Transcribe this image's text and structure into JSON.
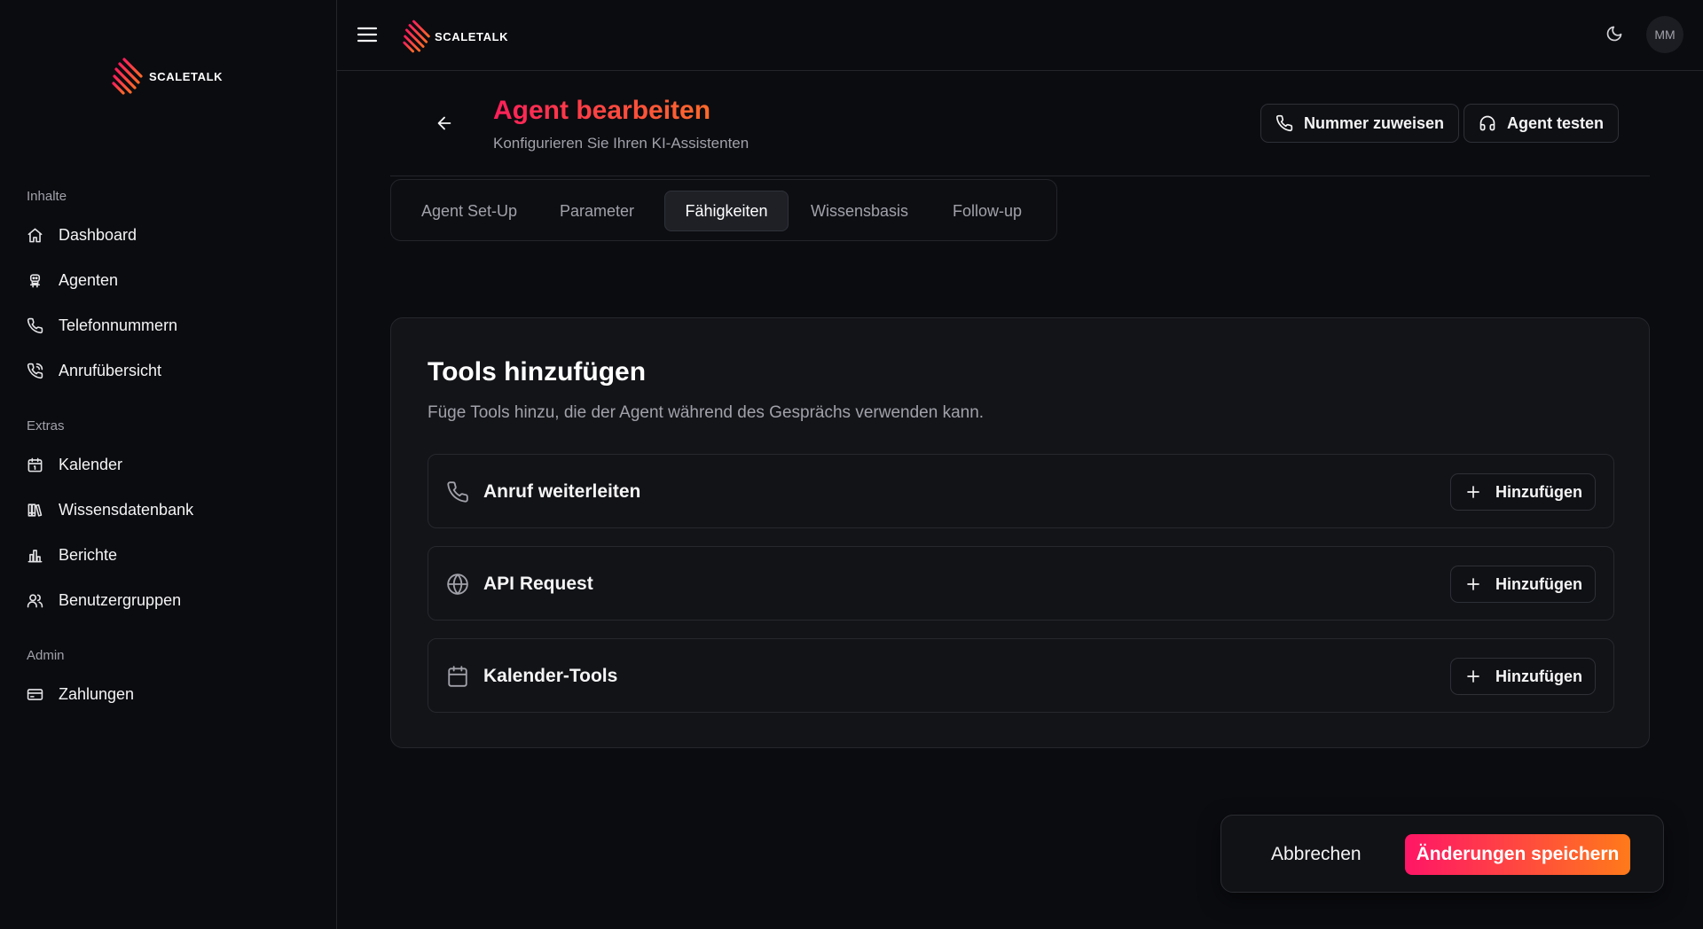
{
  "brand": {
    "name": "SCALETALK"
  },
  "sidebar": {
    "sections": [
      {
        "label": "Inhalte",
        "items": [
          {
            "label": "Dashboard",
            "icon": "home-icon"
          },
          {
            "label": "Agenten",
            "icon": "robot-icon"
          },
          {
            "label": "Telefonnummern",
            "icon": "phone-icon"
          },
          {
            "label": "Anrufübersicht",
            "icon": "phone-call-icon"
          }
        ]
      },
      {
        "label": "Extras",
        "items": [
          {
            "label": "Kalender",
            "icon": "calendar-icon"
          },
          {
            "label": "Wissensdatenbank",
            "icon": "library-icon"
          },
          {
            "label": "Berichte",
            "icon": "bar-chart-icon"
          },
          {
            "label": "Benutzergruppen",
            "icon": "users-icon"
          }
        ]
      },
      {
        "label": "Admin",
        "items": [
          {
            "label": "Zahlungen",
            "icon": "credit-card-icon"
          }
        ]
      }
    ]
  },
  "topbar": {
    "avatar_initials": "MM"
  },
  "header": {
    "title": "Agent bearbeiten",
    "subtitle": "Konfigurieren Sie Ihren KI-Assistenten",
    "assign_number_label": "Nummer zuweisen",
    "test_agent_label": "Agent testen"
  },
  "tabs": [
    {
      "label": "Agent Set-Up"
    },
    {
      "label": "Parameter"
    },
    {
      "label": "Fähigkeiten",
      "active": true
    },
    {
      "label": "Wissensbasis"
    },
    {
      "label": "Follow-up"
    }
  ],
  "tools": {
    "title": "Tools hinzufügen",
    "description": "Füge Tools hinzu, die der Agent während des Gesprächs verwenden kann.",
    "add_label": "Hinzufügen",
    "items": [
      {
        "name": "Anruf weiterleiten",
        "icon": "phone-icon"
      },
      {
        "name": "API Request",
        "icon": "globe-icon"
      },
      {
        "name": "Kalender-Tools",
        "icon": "calendar-icon"
      }
    ]
  },
  "footer": {
    "cancel_label": "Abbrechen",
    "save_label": "Änderungen speichern"
  },
  "colors": {
    "background": "#0b0c10",
    "card": "#131418",
    "accent_start": "#ff1566",
    "accent_end": "#ff7a1a"
  }
}
